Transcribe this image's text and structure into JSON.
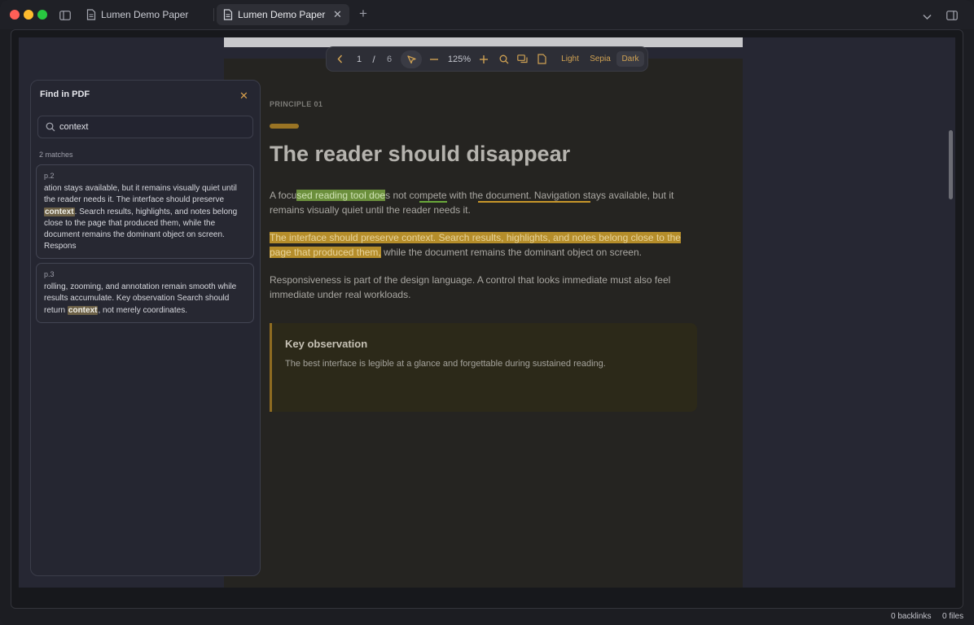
{
  "window": {
    "tabs": [
      {
        "label": "Lumen Demo Paper",
        "active": false
      },
      {
        "label": "Lumen Demo Paper",
        "active": true
      }
    ]
  },
  "toolbar": {
    "current_page": "1",
    "separator": "/",
    "total_pages": "6",
    "zoom": "125%",
    "themes": [
      "Light",
      "Sepia",
      "Dark"
    ],
    "active_theme": "Dark"
  },
  "document": {
    "eyebrow": "PRINCIPLE 01",
    "heading": "The reader should disappear",
    "p1": {
      "a": "A focu",
      "hl1": "sed reading tool doe",
      "b": "s not co",
      "ul1": "mpete",
      "c": " with th",
      "ul2": "e document. Navigation st",
      "d": "ays available, but it remains visually quiet until the reader needs it."
    },
    "p2": {
      "hl": "The interface should preserve context. Search results, highlights, and notes belong close to the page that produced them,",
      "rest": " while the document remains the dominant object on screen."
    },
    "p3": "Responsiveness is part of the design language. A control that looks immediate must also feel immediate under real workloads.",
    "callout": {
      "title": "Key observation",
      "body": "The best interface is legible at a glance and forgettable during sustained reading."
    }
  },
  "find": {
    "title": "Find in PDF",
    "query": "context",
    "match_count": "2 matches",
    "results": [
      {
        "page": "p.2",
        "before": "ation stays available, but it remains visually quiet until the reader needs it. The interface should preserve ",
        "match": "context",
        "after": ". Search results, highlights, and notes belong close to the page that produced them, while the document remains the dominant object on screen. Respons"
      },
      {
        "page": "p.3",
        "before": "rolling, zooming, and annotation remain smooth while results accumulate. Key observation Search should return ",
        "match": "context",
        "after": ", not merely coordinates."
      }
    ]
  },
  "status": {
    "backlinks": "0 backlinks",
    "files": "0 files"
  },
  "colors": {
    "accent": "#d0a253",
    "highlight_green": "#6b8f3c",
    "highlight_yellow": "#b58d2a"
  }
}
